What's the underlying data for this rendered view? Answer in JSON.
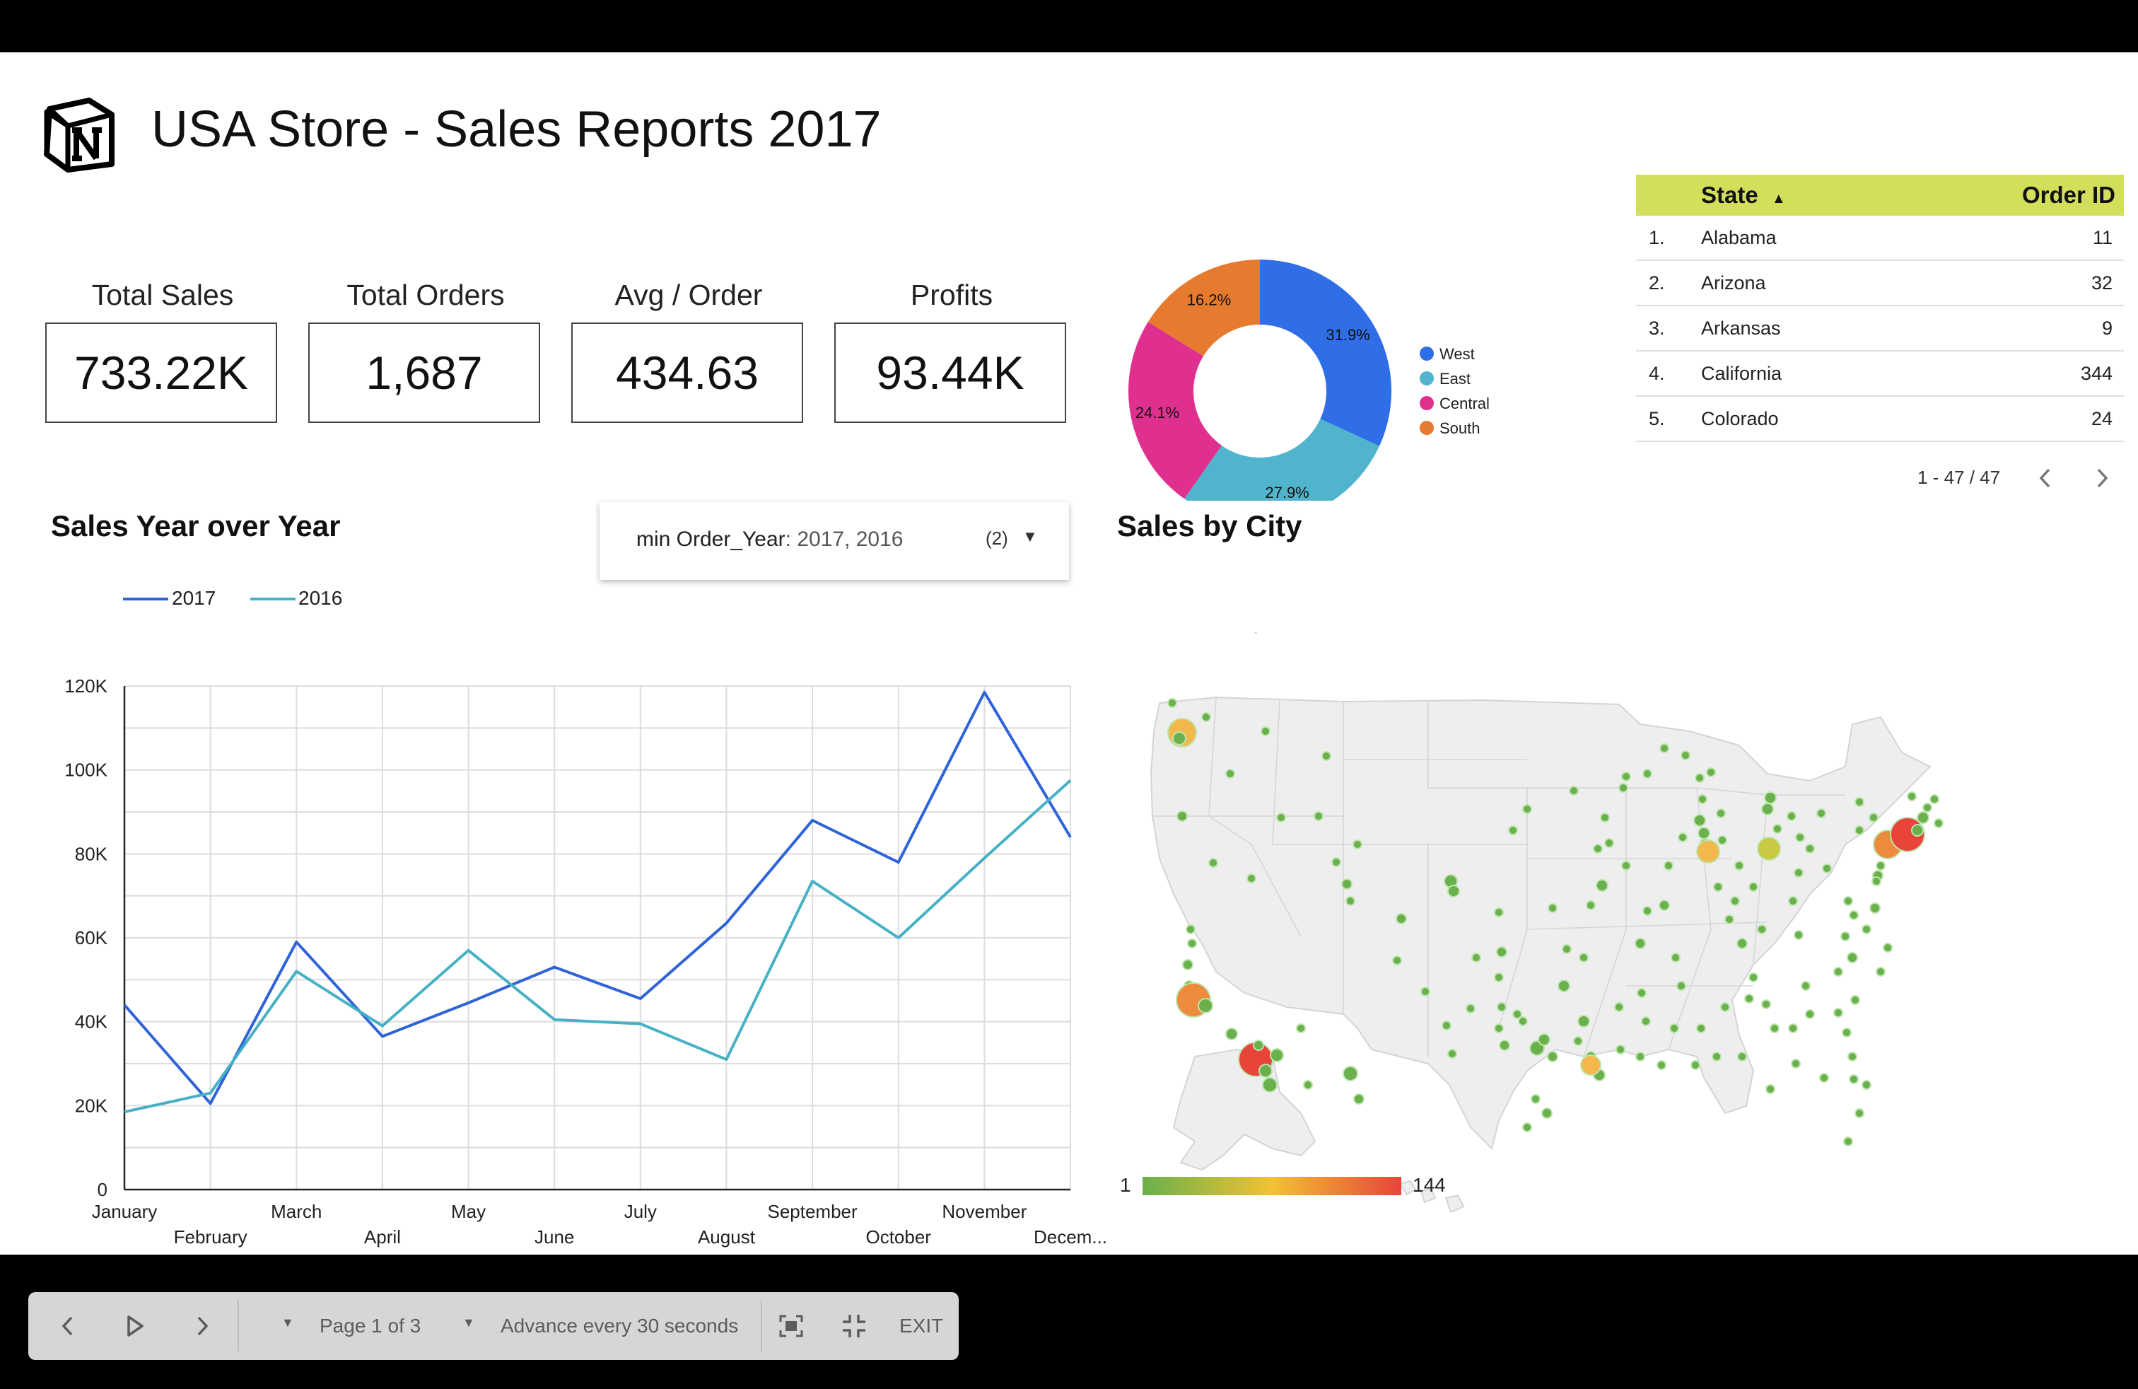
{
  "header": {
    "title": "USA Store - Sales Reports 2017",
    "logo_icon": "notion-logo-icon"
  },
  "kpis": [
    {
      "label": "Total Sales",
      "value": "733.22K"
    },
    {
      "label": "Total Orders",
      "value": "1,687"
    },
    {
      "label": "Avg / Order",
      "value": "434.63"
    },
    {
      "label": "Profits",
      "value": "93.44K"
    }
  ],
  "donut": {
    "chart_data": {
      "type": "pie",
      "series": [
        {
          "name": "West",
          "value": 31.9,
          "label": "31.9%",
          "color": "#2f6ee6"
        },
        {
          "name": "East",
          "value": 27.9,
          "label": "27.9%",
          "color": "#4fb4cc"
        },
        {
          "name": "Central",
          "value": 24.1,
          "label": "24.1%",
          "color": "#e0308f"
        },
        {
          "name": "South",
          "value": 16.2,
          "label": "16.2%",
          "color": "#e67a2e"
        }
      ]
    }
  },
  "table": {
    "headers": {
      "state": "State",
      "order_id": "Order ID",
      "sort_icon": "sort-ascending-icon"
    },
    "rows": [
      {
        "num": "1.",
        "state": "Alabama",
        "order_id": "11"
      },
      {
        "num": "2.",
        "state": "Arizona",
        "order_id": "32"
      },
      {
        "num": "3.",
        "state": "Arkansas",
        "order_id": "9"
      },
      {
        "num": "4.",
        "state": "California",
        "order_id": "344"
      },
      {
        "num": "5.",
        "state": "Colorado",
        "order_id": "24"
      }
    ],
    "pagination": "1 - 47 / 47",
    "prev_icon": "chevron-left-icon",
    "next_icon": "chevron-right-icon",
    "header_color": "#d3de5a"
  },
  "line_section": {
    "title": "Sales Year over Year",
    "filter": {
      "label": "min Order_Year",
      "value": ": 2017, 2016",
      "count": "(2)",
      "icon": "caret-down-icon"
    },
    "legend": [
      {
        "name": "2017",
        "color": "#2f63d8"
      },
      {
        "name": "2016",
        "color": "#46b1c4"
      }
    ]
  },
  "chart_data": {
    "type": "line",
    "categories": [
      "January",
      "February",
      "March",
      "April",
      "May",
      "June",
      "July",
      "August",
      "September",
      "October",
      "November",
      "Decem..."
    ],
    "series": [
      {
        "name": "2017",
        "color": "#2f63d8",
        "values": [
          44000,
          20500,
          59000,
          36500,
          44500,
          53000,
          45500,
          63500,
          88000,
          78000,
          118500,
          84000
        ]
      },
      {
        "name": "2016",
        "color": "#46b1c4",
        "values": [
          18500,
          23000,
          52000,
          39000,
          57000,
          40500,
          39500,
          31000,
          73500,
          60000,
          79000,
          97500
        ]
      }
    ],
    "y_ticks": [
      "0",
      "20K",
      "40K",
      "60K",
      "80K",
      "100K",
      "120K"
    ],
    "ylim": [
      0,
      120000
    ],
    "grid": true,
    "legend": "top-left"
  },
  "map_section": {
    "title": "Sales by City",
    "scale_min": "1",
    "scale_max": "144",
    "scale_colors": [
      "#6ab04c",
      "#f1c232",
      "#e8443a"
    ]
  },
  "controls": {
    "prev_icon": "chevron-left-icon",
    "play_icon": "play-icon",
    "next_icon": "chevron-right-icon",
    "page_label": "Page 1 of 3",
    "advance_label": "Advance every 30 seconds",
    "fit_icon": "fit-screen-icon",
    "exit_fullscreen_icon": "exit-fullscreen-icon",
    "exit_label": "EXIT"
  }
}
